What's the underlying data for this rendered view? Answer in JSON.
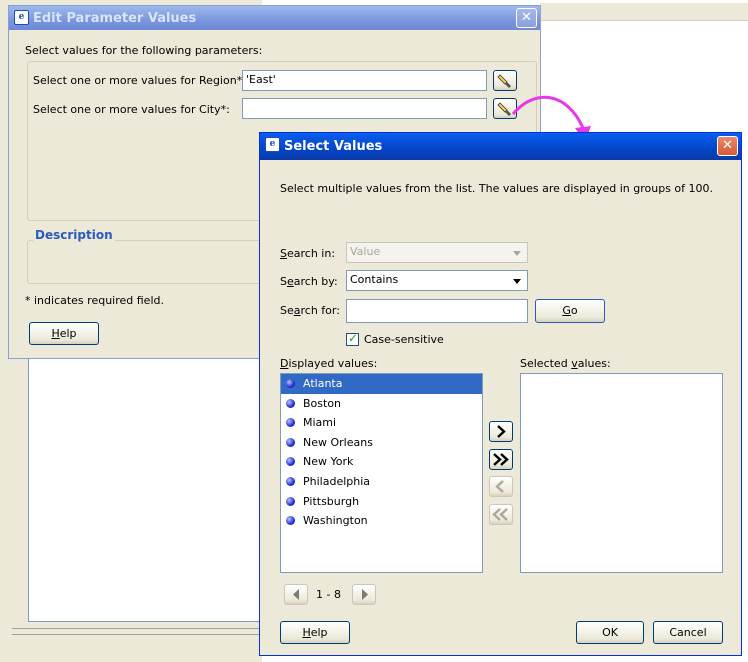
{
  "edit_dialog": {
    "title": "Edit Parameter Values",
    "instruction": "Select values for the following parameters:",
    "region_label": "Select one or more values for Region*:",
    "region_value": "'East'",
    "city_label": "Select one or more values for City*:",
    "city_value": "",
    "description_label": "Description",
    "required_note": "* indicates required field.",
    "help_label": "elp",
    "help_mnemonic": "H"
  },
  "select_dialog": {
    "title": "Select Values",
    "instruction": "Select multiple values from the list. The values are displayed in groups of 100.",
    "search_in_label_mn": "S",
    "search_in_label": "earch in:",
    "search_in_value": "Value",
    "search_by_label_pre": "S",
    "search_by_label_mn": "e",
    "search_by_label": "arch by:",
    "search_by_value": "Contains",
    "search_for_label_pre": "Se",
    "search_for_label_mn": "a",
    "search_for_label": "rch for:",
    "search_for_value": "",
    "go_mn": "G",
    "go_label": "o",
    "case_sensitive_label": "Case-sensitive",
    "case_sensitive_checked": true,
    "displayed_label_mn": "D",
    "displayed_label": "isplayed values:",
    "selected_label_pre": "Selected ",
    "selected_label_mn": "v",
    "selected_label": "alues:",
    "displayed_values": [
      "Atlanta",
      "Boston",
      "Miami",
      "New Orleans",
      "New York",
      "Philadelphia",
      "Pittsburgh",
      "Washington"
    ],
    "selected_item": "Atlanta",
    "selected_values": [],
    "pager_range": "1 - 8",
    "help_mn": "H",
    "help_label": "elp",
    "ok_label": "OK",
    "cancel_label": "Cancel"
  },
  "colors": {
    "accent_arrow": "#e838e8",
    "title_active": "#0a5ff0",
    "selection": "#316ac5"
  }
}
